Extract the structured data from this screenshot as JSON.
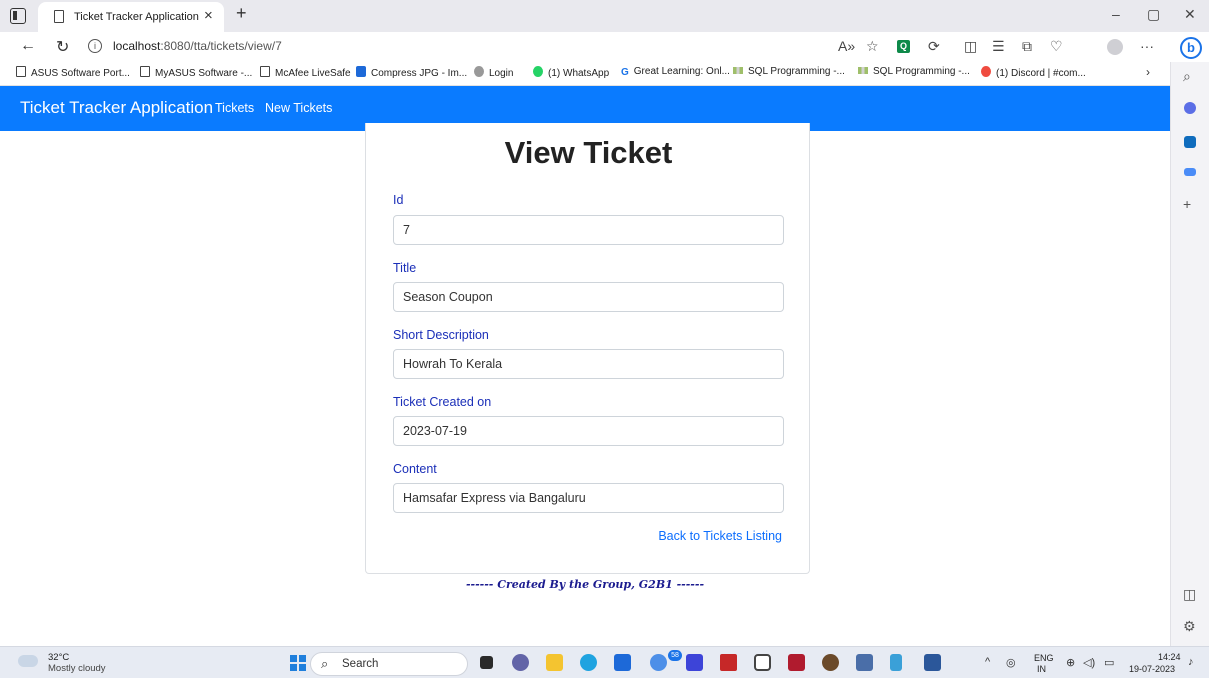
{
  "browser": {
    "tab_title": "Ticket Tracker Application",
    "tab_close": "×",
    "new_tab": "+",
    "url_host": "localhost",
    "url_rest": ":8080/tta/tickets/view/7",
    "window_minimize": "–",
    "window_restore": "▢",
    "window_close": "✕",
    "more_menu": "···",
    "bookmarks": [
      {
        "label": "ASUS Software Port...",
        "icon": "page-icon"
      },
      {
        "label": "MyASUS Software -...",
        "icon": "page-icon"
      },
      {
        "label": "McAfee LiveSafe",
        "icon": "page-icon"
      },
      {
        "label": "Compress JPG - Im...",
        "icon": "compress-icon"
      },
      {
        "label": "Login",
        "icon": "globe-icon"
      },
      {
        "label": "(1) WhatsApp",
        "icon": "whatsapp-icon"
      },
      {
        "label": "Great Learning: Onl...",
        "icon": "great-learning-icon"
      },
      {
        "label": "SQL Programming -...",
        "icon": "sql-icon"
      },
      {
        "label": "SQL Programming -...",
        "icon": "sql-icon"
      },
      {
        "label": "(1) Discord | #com...",
        "icon": "discord-icon"
      }
    ]
  },
  "app": {
    "brand": "Ticket Tracker Application",
    "nav": [
      "Tickets",
      "New Tickets"
    ],
    "page_title": "View Ticket",
    "fields": [
      {
        "label": "Id",
        "value": "7"
      },
      {
        "label": "Title",
        "value": "Season Coupon"
      },
      {
        "label": "Short Description",
        "value": "Howrah To Kerala"
      },
      {
        "label": "Ticket Created on",
        "value": "2023-07-19"
      },
      {
        "label": "Content",
        "value": "Hamsafar Express via Bangaluru"
      }
    ],
    "back_link": "Back to Tickets Listing",
    "footer_note": "------ Created By the Group, G2B1 ------"
  },
  "taskbar": {
    "temperature": "32°C",
    "weather": "Mostly cloudy",
    "search_label": "Search",
    "notification_badge": "58",
    "lang_top": "ENG",
    "lang_bottom": "IN",
    "time": "14:24",
    "date": "19-07-2023"
  },
  "colors": {
    "navbar": "#0a7bff",
    "field_label": "#1b2fb8",
    "link": "#0d6efd",
    "footer_note": "#1b1b8f"
  }
}
